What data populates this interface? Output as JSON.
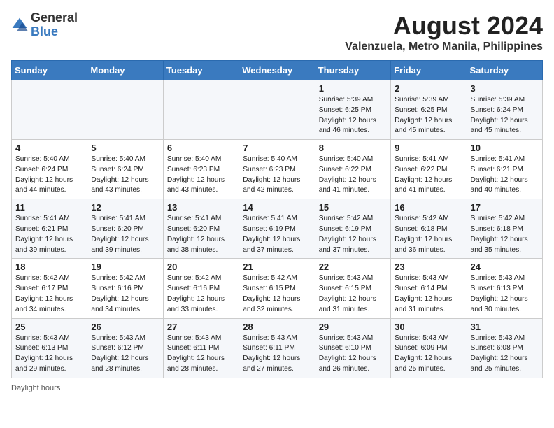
{
  "logo": {
    "general": "General",
    "blue": "Blue"
  },
  "title": "August 2024",
  "location": "Valenzuela, Metro Manila, Philippines",
  "days_of_week": [
    "Sunday",
    "Monday",
    "Tuesday",
    "Wednesday",
    "Thursday",
    "Friday",
    "Saturday"
  ],
  "footer": "Daylight hours",
  "weeks": [
    [
      {
        "day": "",
        "info": ""
      },
      {
        "day": "",
        "info": ""
      },
      {
        "day": "",
        "info": ""
      },
      {
        "day": "",
        "info": ""
      },
      {
        "day": "1",
        "info": "Sunrise: 5:39 AM\nSunset: 6:25 PM\nDaylight: 12 hours\nand 46 minutes."
      },
      {
        "day": "2",
        "info": "Sunrise: 5:39 AM\nSunset: 6:25 PM\nDaylight: 12 hours\nand 45 minutes."
      },
      {
        "day": "3",
        "info": "Sunrise: 5:39 AM\nSunset: 6:24 PM\nDaylight: 12 hours\nand 45 minutes."
      }
    ],
    [
      {
        "day": "4",
        "info": "Sunrise: 5:40 AM\nSunset: 6:24 PM\nDaylight: 12 hours\nand 44 minutes."
      },
      {
        "day": "5",
        "info": "Sunrise: 5:40 AM\nSunset: 6:24 PM\nDaylight: 12 hours\nand 43 minutes."
      },
      {
        "day": "6",
        "info": "Sunrise: 5:40 AM\nSunset: 6:23 PM\nDaylight: 12 hours\nand 43 minutes."
      },
      {
        "day": "7",
        "info": "Sunrise: 5:40 AM\nSunset: 6:23 PM\nDaylight: 12 hours\nand 42 minutes."
      },
      {
        "day": "8",
        "info": "Sunrise: 5:40 AM\nSunset: 6:22 PM\nDaylight: 12 hours\nand 41 minutes."
      },
      {
        "day": "9",
        "info": "Sunrise: 5:41 AM\nSunset: 6:22 PM\nDaylight: 12 hours\nand 41 minutes."
      },
      {
        "day": "10",
        "info": "Sunrise: 5:41 AM\nSunset: 6:21 PM\nDaylight: 12 hours\nand 40 minutes."
      }
    ],
    [
      {
        "day": "11",
        "info": "Sunrise: 5:41 AM\nSunset: 6:21 PM\nDaylight: 12 hours\nand 39 minutes."
      },
      {
        "day": "12",
        "info": "Sunrise: 5:41 AM\nSunset: 6:20 PM\nDaylight: 12 hours\nand 39 minutes."
      },
      {
        "day": "13",
        "info": "Sunrise: 5:41 AM\nSunset: 6:20 PM\nDaylight: 12 hours\nand 38 minutes."
      },
      {
        "day": "14",
        "info": "Sunrise: 5:41 AM\nSunset: 6:19 PM\nDaylight: 12 hours\nand 37 minutes."
      },
      {
        "day": "15",
        "info": "Sunrise: 5:42 AM\nSunset: 6:19 PM\nDaylight: 12 hours\nand 37 minutes."
      },
      {
        "day": "16",
        "info": "Sunrise: 5:42 AM\nSunset: 6:18 PM\nDaylight: 12 hours\nand 36 minutes."
      },
      {
        "day": "17",
        "info": "Sunrise: 5:42 AM\nSunset: 6:18 PM\nDaylight: 12 hours\nand 35 minutes."
      }
    ],
    [
      {
        "day": "18",
        "info": "Sunrise: 5:42 AM\nSunset: 6:17 PM\nDaylight: 12 hours\nand 34 minutes."
      },
      {
        "day": "19",
        "info": "Sunrise: 5:42 AM\nSunset: 6:16 PM\nDaylight: 12 hours\nand 34 minutes."
      },
      {
        "day": "20",
        "info": "Sunrise: 5:42 AM\nSunset: 6:16 PM\nDaylight: 12 hours\nand 33 minutes."
      },
      {
        "day": "21",
        "info": "Sunrise: 5:42 AM\nSunset: 6:15 PM\nDaylight: 12 hours\nand 32 minutes."
      },
      {
        "day": "22",
        "info": "Sunrise: 5:43 AM\nSunset: 6:15 PM\nDaylight: 12 hours\nand 31 minutes."
      },
      {
        "day": "23",
        "info": "Sunrise: 5:43 AM\nSunset: 6:14 PM\nDaylight: 12 hours\nand 31 minutes."
      },
      {
        "day": "24",
        "info": "Sunrise: 5:43 AM\nSunset: 6:13 PM\nDaylight: 12 hours\nand 30 minutes."
      }
    ],
    [
      {
        "day": "25",
        "info": "Sunrise: 5:43 AM\nSunset: 6:13 PM\nDaylight: 12 hours\nand 29 minutes."
      },
      {
        "day": "26",
        "info": "Sunrise: 5:43 AM\nSunset: 6:12 PM\nDaylight: 12 hours\nand 28 minutes."
      },
      {
        "day": "27",
        "info": "Sunrise: 5:43 AM\nSunset: 6:11 PM\nDaylight: 12 hours\nand 28 minutes."
      },
      {
        "day": "28",
        "info": "Sunrise: 5:43 AM\nSunset: 6:11 PM\nDaylight: 12 hours\nand 27 minutes."
      },
      {
        "day": "29",
        "info": "Sunrise: 5:43 AM\nSunset: 6:10 PM\nDaylight: 12 hours\nand 26 minutes."
      },
      {
        "day": "30",
        "info": "Sunrise: 5:43 AM\nSunset: 6:09 PM\nDaylight: 12 hours\nand 25 minutes."
      },
      {
        "day": "31",
        "info": "Sunrise: 5:43 AM\nSunset: 6:08 PM\nDaylight: 12 hours\nand 25 minutes."
      }
    ]
  ]
}
